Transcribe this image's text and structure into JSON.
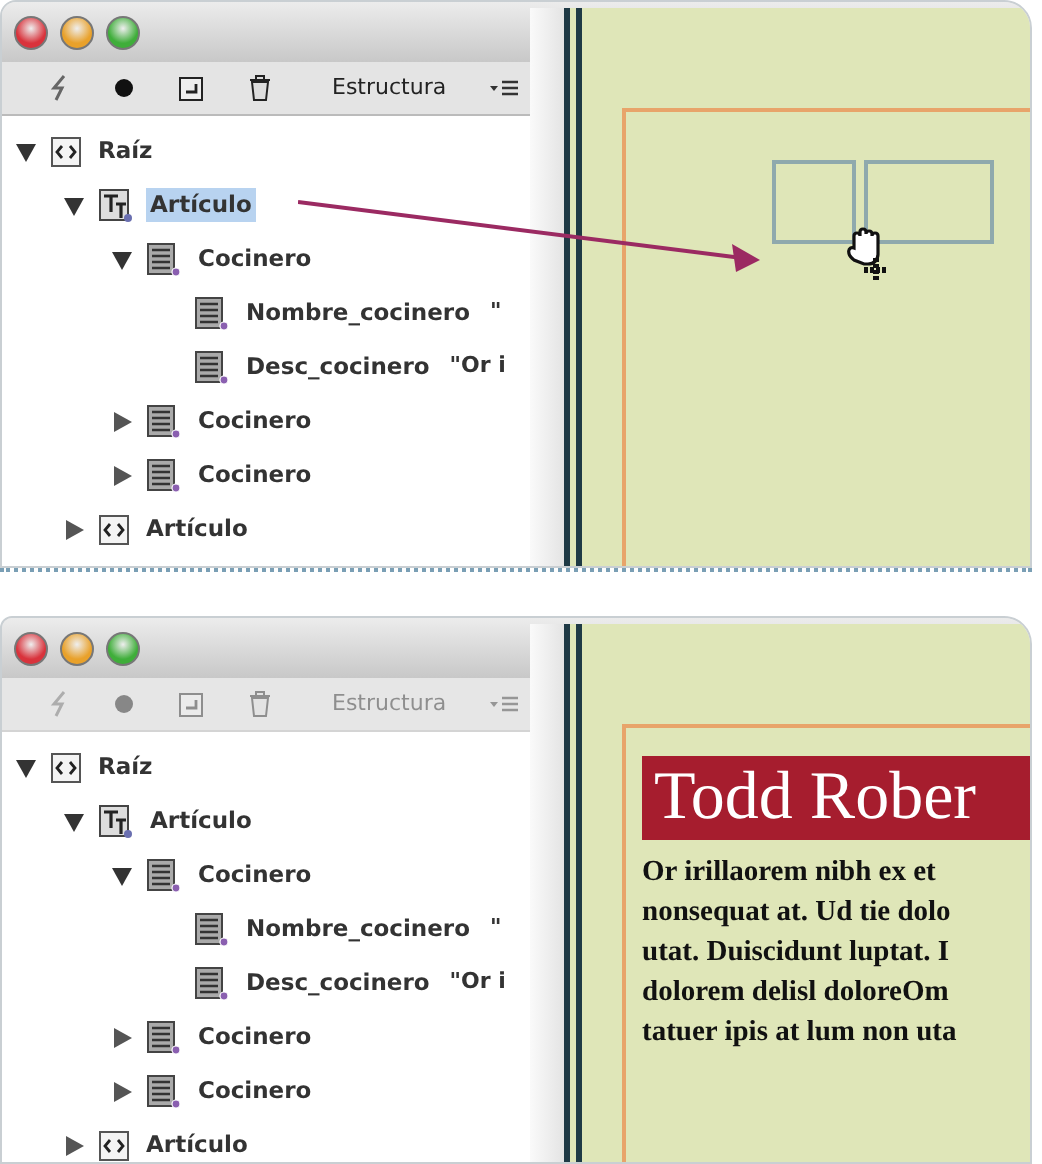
{
  "panels": [
    {
      "toolbar": {
        "disabled": false,
        "title": "Estructura"
      },
      "drag_arrow": true,
      "tree": [
        {
          "kind": "root",
          "label": "Raíz",
          "expanded": true,
          "selected": false,
          "children": [
            {
              "kind": "story",
              "label": "Artículo",
              "expanded": true,
              "selected": true,
              "children": [
                {
                  "kind": "element",
                  "label": "Cocinero",
                  "expanded": true,
                  "selected": false,
                  "children": [
                    {
                      "kind": "element",
                      "label": "Nombre_cocinero",
                      "value": "\"",
                      "selected": false
                    },
                    {
                      "kind": "element",
                      "label": "Desc_cocinero",
                      "value": "\"Or i",
                      "selected": false
                    }
                  ]
                },
                {
                  "kind": "element",
                  "label": "Cocinero",
                  "expanded": false,
                  "selected": false
                },
                {
                  "kind": "element",
                  "label": "Cocinero",
                  "expanded": false,
                  "selected": false
                }
              ]
            },
            {
              "kind": "root",
              "label": "Artículo",
              "expanded": false,
              "selected": false
            }
          ]
        }
      ],
      "canvas": {
        "kind": "frames"
      }
    },
    {
      "toolbar": {
        "disabled": true,
        "title": "Estructura"
      },
      "drag_arrow": false,
      "tree": [
        {
          "kind": "root",
          "label": "Raíz",
          "expanded": true,
          "selected": false,
          "children": [
            {
              "kind": "story",
              "label": "Artículo",
              "expanded": true,
              "selected": false,
              "children": [
                {
                  "kind": "element",
                  "label": "Cocinero",
                  "expanded": true,
                  "selected": false,
                  "children": [
                    {
                      "kind": "element",
                      "label": "Nombre_cocinero",
                      "value": "\"",
                      "selected": false
                    },
                    {
                      "kind": "element",
                      "label": "Desc_cocinero",
                      "value": "\"Or i",
                      "selected": false
                    }
                  ]
                },
                {
                  "kind": "element",
                  "label": "Cocinero",
                  "expanded": false,
                  "selected": false
                },
                {
                  "kind": "element",
                  "label": "Cocinero",
                  "expanded": false,
                  "selected": false
                }
              ]
            },
            {
              "kind": "root",
              "label": "Artículo",
              "expanded": false,
              "selected": false
            }
          ]
        }
      ],
      "canvas": {
        "kind": "article",
        "heading": "Todd Rober",
        "lines": [
          "Or irillaorem nibh ex et",
          "nonsequat at. Ud tie dolo",
          "utat. Duiscidunt luptat. I",
          "dolorem delisl doloreOm",
          "tatuer ipis at lum non uta"
        ]
      }
    }
  ]
}
